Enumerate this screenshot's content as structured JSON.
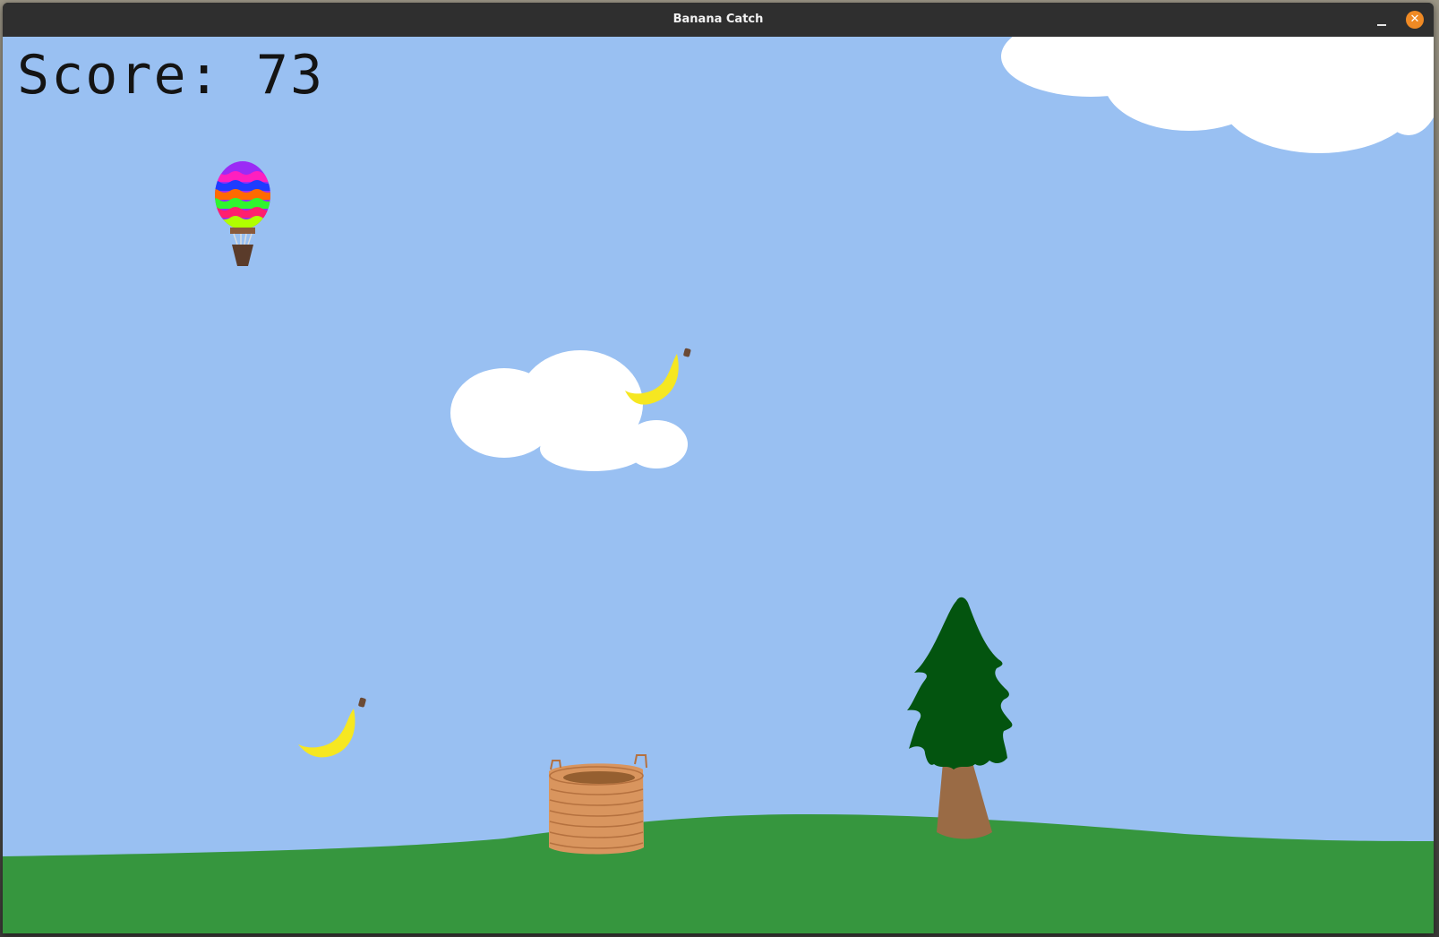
{
  "window": {
    "title": "Banana Catch",
    "minimize_icon": "minimize-icon",
    "close_icon": "close-icon",
    "close_glyph": "✕",
    "close_color": "#f08a24"
  },
  "hud": {
    "score_text": "Score: 73",
    "score_value": 73
  },
  "scene": {
    "sky_color": "#99c0f2",
    "ground_color": "#36963e",
    "cloud_color": "#ffffff",
    "banana_color": "#f6e721",
    "banana_count": 2,
    "basket_color": "#d9955e",
    "tree_foliage_color": "#03540f",
    "tree_trunk_color": "#9a6b45",
    "balloon_stripes": [
      "#9b2bf5",
      "#ff1fbf",
      "#1e3cff",
      "#ff6a00",
      "#2ff52f",
      "#ff1f6e",
      "#b0ff00"
    ]
  }
}
